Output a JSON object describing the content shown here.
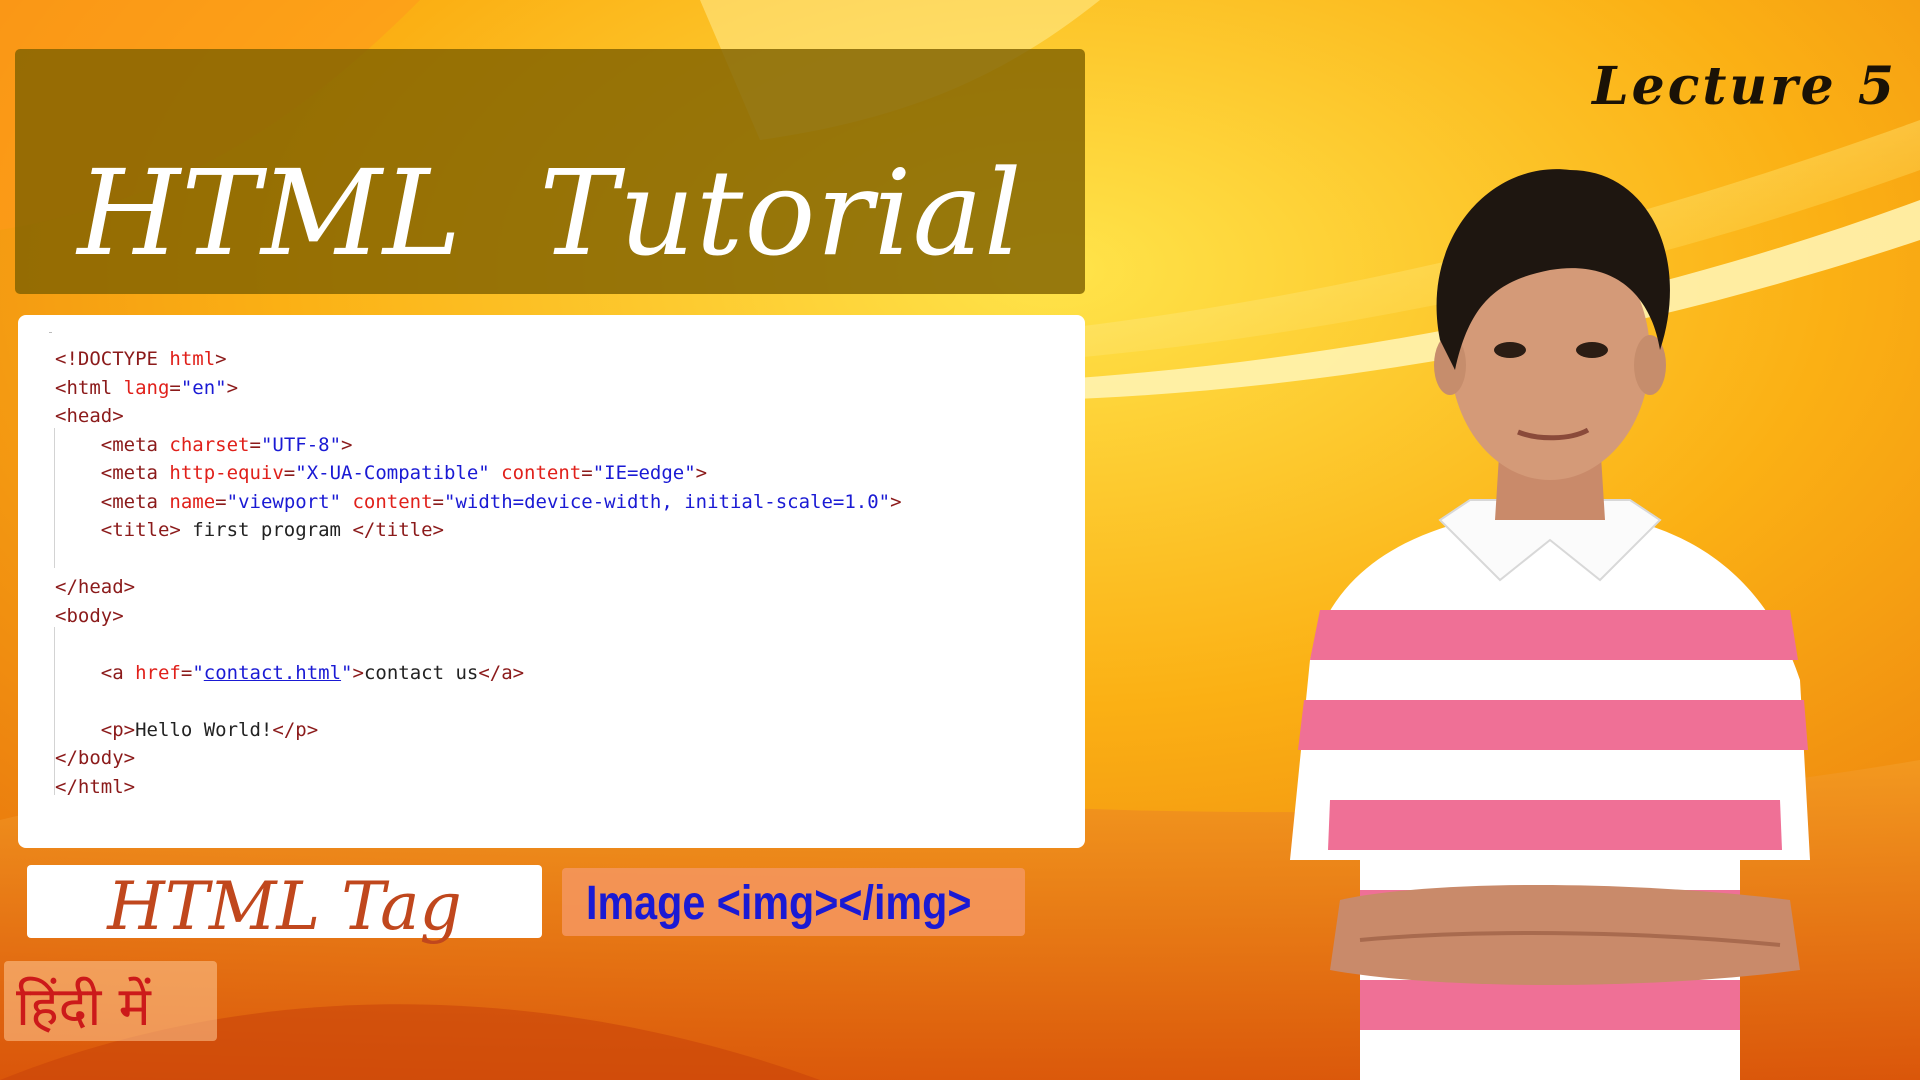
{
  "title": "HTML  Tutorial",
  "lecture": "Lecture 5",
  "code_lines": [
    [
      [
        "tg",
        "<!DOCTYPE "
      ],
      [
        "at",
        "html"
      ],
      [
        "tg",
        ">"
      ]
    ],
    [
      [
        "tg",
        "<html "
      ],
      [
        "at",
        "lang"
      ],
      [
        "tg",
        "="
      ],
      [
        "vl",
        "\"en\""
      ],
      [
        "tg",
        ">"
      ]
    ],
    [
      [
        "tg",
        "<head>"
      ]
    ],
    [
      [
        "tx",
        "    "
      ],
      [
        "tg",
        "<meta "
      ],
      [
        "at",
        "charset"
      ],
      [
        "tg",
        "="
      ],
      [
        "vl",
        "\"UTF-8\""
      ],
      [
        "tg",
        ">"
      ]
    ],
    [
      [
        "tx",
        "    "
      ],
      [
        "tg",
        "<meta "
      ],
      [
        "at",
        "http-equiv"
      ],
      [
        "tg",
        "="
      ],
      [
        "vl",
        "\"X-UA-Compatible\" "
      ],
      [
        "at",
        "content"
      ],
      [
        "tg",
        "="
      ],
      [
        "vl",
        "\"IE=edge\""
      ],
      [
        "tg",
        ">"
      ]
    ],
    [
      [
        "tx",
        "    "
      ],
      [
        "tg",
        "<meta "
      ],
      [
        "at",
        "name"
      ],
      [
        "tg",
        "="
      ],
      [
        "vl",
        "\"viewport\" "
      ],
      [
        "at",
        "content"
      ],
      [
        "tg",
        "="
      ],
      [
        "vl",
        "\"width=device-width, initial-scale=1.0\""
      ],
      [
        "tg",
        ">"
      ]
    ],
    [
      [
        "tx",
        "    "
      ],
      [
        "tg",
        "<title>"
      ],
      [
        "tx",
        " first program "
      ],
      [
        "tg",
        "</title>"
      ]
    ],
    [
      [
        "tx",
        ""
      ]
    ],
    [
      [
        "tg",
        "</head>"
      ]
    ],
    [
      [
        "tg",
        "<body>"
      ]
    ],
    [
      [
        "tx",
        ""
      ]
    ],
    [
      [
        "tx",
        "    "
      ],
      [
        "tg",
        "<a "
      ],
      [
        "at",
        "href"
      ],
      [
        "tg",
        "="
      ],
      [
        "vl",
        "\""
      ],
      [
        "lk",
        "contact.html"
      ],
      [
        "vl",
        "\""
      ],
      [
        "tg",
        ">"
      ],
      [
        "tx",
        "contact us"
      ],
      [
        "tg",
        "</a>"
      ]
    ],
    [
      [
        "tx",
        ""
      ]
    ],
    [
      [
        "tx",
        "    "
      ],
      [
        "tg",
        "<p>"
      ],
      [
        "tx",
        "Hello World!"
      ],
      [
        "tg",
        "</p>"
      ]
    ],
    [
      [
        "tg",
        "</body>"
      ]
    ],
    [
      [
        "tg",
        "</html>"
      ]
    ]
  ],
  "tag_label": "HTML Tag",
  "image_tag": "Image <img></img>",
  "hindi_label": "हिंदी में",
  "colors": {
    "background_orange": "#f08a10",
    "background_yellow": "#ffd200",
    "title_box": "#806200",
    "code_tag": "#8b1a1a",
    "code_attr": "#e0201a",
    "code_value": "#1a1ad4",
    "tag_label": "#c0471d",
    "image_tag": "#1a1ad4",
    "hindi": "#cc1a1a",
    "shirt_pink": "#ef7096"
  }
}
